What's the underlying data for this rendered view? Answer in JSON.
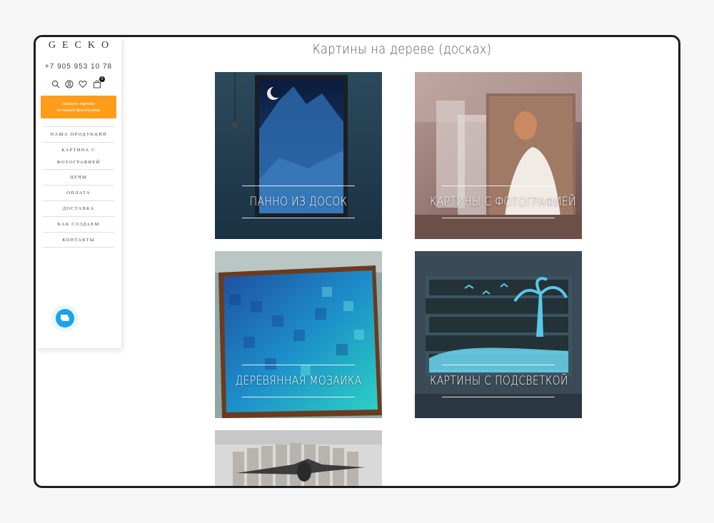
{
  "brand": {
    "logo": "GECKO",
    "phone": "+7 905 953 10 78",
    "cart_count": "0"
  },
  "header_icons": [
    "search-icon",
    "user-icon",
    "heart-icon",
    "bag-icon"
  ],
  "cta": {
    "line1": "Заказать картину",
    "line2": "по вашей фотографии"
  },
  "nav": [
    {
      "label": "НАША ПРОДУКЦИЯ"
    },
    {
      "label": "КАРТИНА С ФОТОГРАФИЕЙ"
    },
    {
      "label": "ЦЕНЫ"
    },
    {
      "label": "ОПЛАТА"
    },
    {
      "label": "ДОСТАВКА"
    },
    {
      "label": "КАК СОЗДАЕМ"
    },
    {
      "label": "КОНТАКТЫ"
    }
  ],
  "page": {
    "title": "Картины на дереве (досках)"
  },
  "categories": [
    {
      "label": "ПАННО ИЗ ДОСОК"
    },
    {
      "label": "КАРТИНЫ С ФОТОГРАФИЕЙ"
    },
    {
      "label": "ДЕРЕВЯННАЯ МОЗАИКА"
    },
    {
      "label": "КАРТИНЫ С ПОДСВЕТКОЙ"
    },
    {
      "label": ""
    }
  ],
  "colors": {
    "accent": "#ff9c1a",
    "chat": "#1aa3e8",
    "frame": "#1d1d1f"
  }
}
